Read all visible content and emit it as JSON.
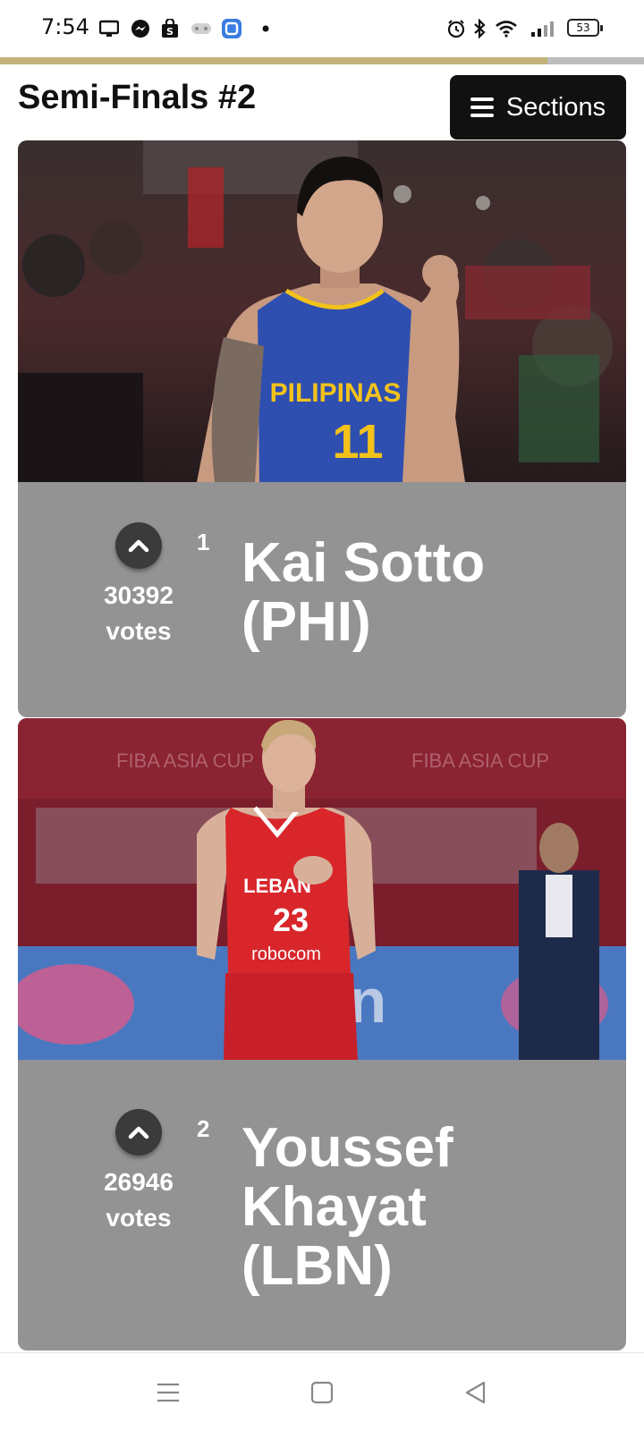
{
  "status_bar": {
    "time": "7:54",
    "battery": "53",
    "left_icons": [
      "monitor-icon",
      "messenger-icon",
      "shopping-bag-icon",
      "gamepad-icon",
      "app-square-icon",
      "dot-icon"
    ],
    "right_icons": [
      "alarm-icon",
      "bluetooth-icon",
      "wifi-icon",
      "signal-icon",
      "battery-icon"
    ]
  },
  "progress": {
    "value": 0.85,
    "fill_color": "#c4b27a",
    "track_color": "#bdbdbd"
  },
  "header": {
    "title": "Semi-Finals #2",
    "sections_label": "Sections"
  },
  "entries": [
    {
      "rank": "1",
      "votes": "30392",
      "votes_label": "votes",
      "name_lines": [
        "Kai Sotto",
        "(PHI)"
      ],
      "photo": {
        "jersey_text": "PILIPINAS",
        "jersey_number": "11",
        "jersey_color": "#2f4fb0",
        "trim_color": "#f2c21a"
      }
    },
    {
      "rank": "2",
      "votes": "26946",
      "votes_label": "votes",
      "name_lines": [
        "Youssef",
        "Khayat",
        "(LBN)"
      ],
      "photo": {
        "jersey_text": "LEBAN",
        "jersey_number": "23",
        "jersey_sponsor": "robocom",
        "jersey_color": "#d8262b",
        "trim_color": "#ffffff"
      }
    }
  ],
  "nav_bar": [
    "menu-icon",
    "home-square-icon",
    "back-triangle-icon"
  ]
}
